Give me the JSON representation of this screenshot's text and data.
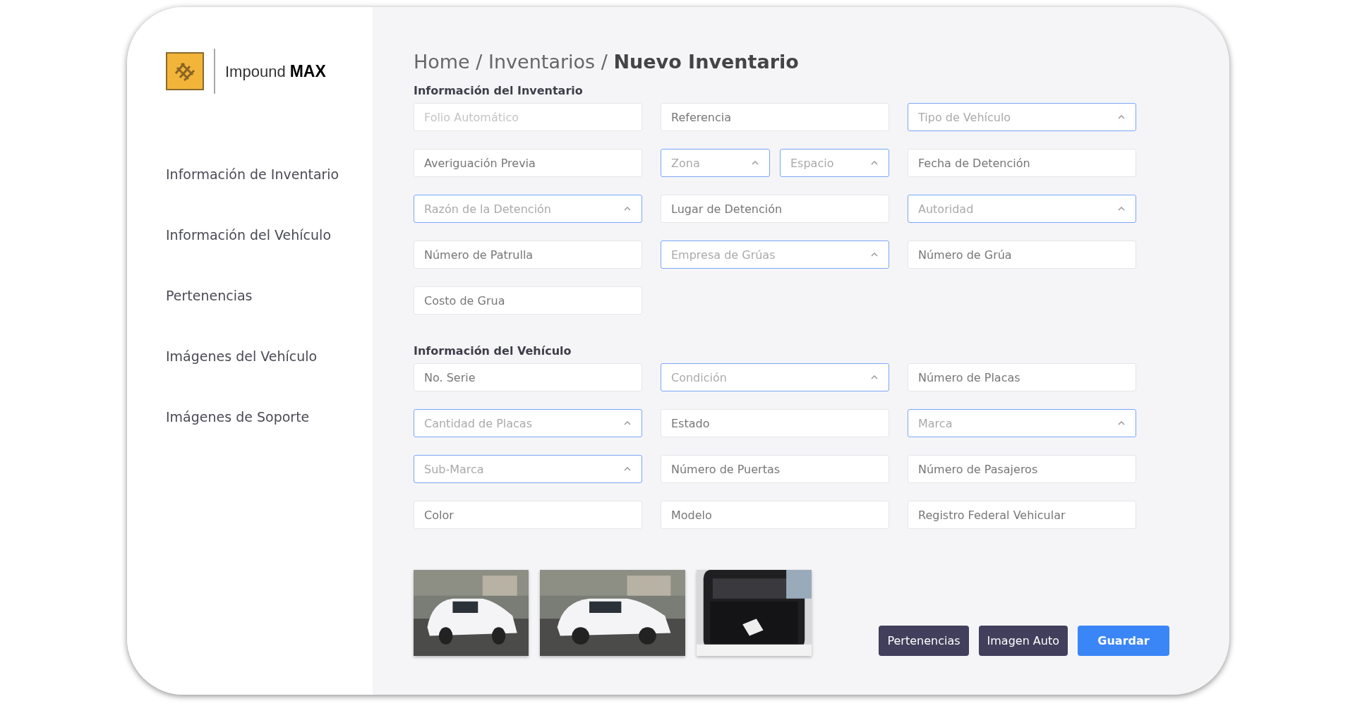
{
  "logo": {
    "name": "Impound",
    "emphasis": "MAX"
  },
  "sidebar": {
    "items": [
      {
        "label": "Información de Inventario"
      },
      {
        "label": "Información del Vehículo"
      },
      {
        "label": "Pertenencias"
      },
      {
        "label": "Imágenes del Vehículo"
      },
      {
        "label": "Imágenes de Soporte"
      }
    ]
  },
  "breadcrumb": {
    "items": [
      "Home",
      "Inventarios"
    ],
    "separator": "/",
    "current": "Nuevo Inventario"
  },
  "sections": [
    {
      "title": "Información del Inventario",
      "rows": [
        [
          [
            {
              "kind": "text",
              "placeholder": "Folio Automático",
              "disabled": true
            }
          ],
          [
            {
              "kind": "text",
              "placeholder": "Referencia",
              "disabled": false
            }
          ],
          [
            {
              "kind": "select",
              "placeholder": "Tipo de Vehículo",
              "disabled": false
            }
          ]
        ],
        [
          [
            {
              "kind": "text",
              "placeholder": "Averiguación Previa",
              "disabled": false
            }
          ],
          [
            {
              "kind": "select",
              "placeholder": "Zona",
              "disabled": false
            },
            {
              "kind": "select",
              "placeholder": "Espacio",
              "disabled": false
            }
          ],
          [
            {
              "kind": "text",
              "placeholder": "Fecha de Detención",
              "disabled": false
            }
          ]
        ],
        [
          [
            {
              "kind": "select",
              "placeholder": "Razón de la Detención",
              "disabled": false
            }
          ],
          [
            {
              "kind": "text",
              "placeholder": "Lugar de Detención",
              "disabled": false
            }
          ],
          [
            {
              "kind": "select",
              "placeholder": "Autoridad",
              "disabled": false
            }
          ]
        ],
        [
          [
            {
              "kind": "text",
              "placeholder": "Número de Patrulla",
              "disabled": false
            }
          ],
          [
            {
              "kind": "select",
              "placeholder": "Empresa de Grúas",
              "disabled": false
            }
          ],
          [
            {
              "kind": "text",
              "placeholder": "Número de Grúa",
              "disabled": false
            }
          ]
        ],
        [
          [
            {
              "kind": "text",
              "placeholder": "Costo de Grua",
              "disabled": false
            }
          ]
        ]
      ]
    },
    {
      "title": "Información del Vehículo",
      "rows": [
        [
          [
            {
              "kind": "text",
              "placeholder": "No. Serie",
              "disabled": false
            }
          ],
          [
            {
              "kind": "select",
              "placeholder": "Condición",
              "disabled": false
            }
          ],
          [
            {
              "kind": "text",
              "placeholder": "Número de Placas",
              "disabled": false
            }
          ]
        ],
        [
          [
            {
              "kind": "select",
              "placeholder": "Cantidad de Placas",
              "disabled": false
            }
          ],
          [
            {
              "kind": "text",
              "placeholder": "Estado",
              "disabled": false
            }
          ],
          [
            {
              "kind": "select",
              "placeholder": "Marca",
              "disabled": false
            }
          ]
        ],
        [
          [
            {
              "kind": "select",
              "placeholder": "Sub-Marca",
              "disabled": false
            }
          ],
          [
            {
              "kind": "text",
              "placeholder": "Número de Puertas",
              "disabled": false
            }
          ],
          [
            {
              "kind": "text",
              "placeholder": "Número de Pasajeros",
              "disabled": false
            }
          ]
        ],
        [
          [
            {
              "kind": "text",
              "placeholder": "Color",
              "disabled": false
            }
          ],
          [
            {
              "kind": "text",
              "placeholder": "Modelo",
              "disabled": false
            }
          ],
          [
            {
              "kind": "text",
              "placeholder": "Registro Federal Vehicular",
              "disabled": false
            }
          ]
        ]
      ]
    }
  ],
  "buttons": [
    {
      "label": "Pertenencias",
      "kind": "secondary"
    },
    {
      "label": "Imagen Auto",
      "kind": "secondary"
    },
    {
      "label": "Guardar",
      "kind": "primary"
    }
  ]
}
